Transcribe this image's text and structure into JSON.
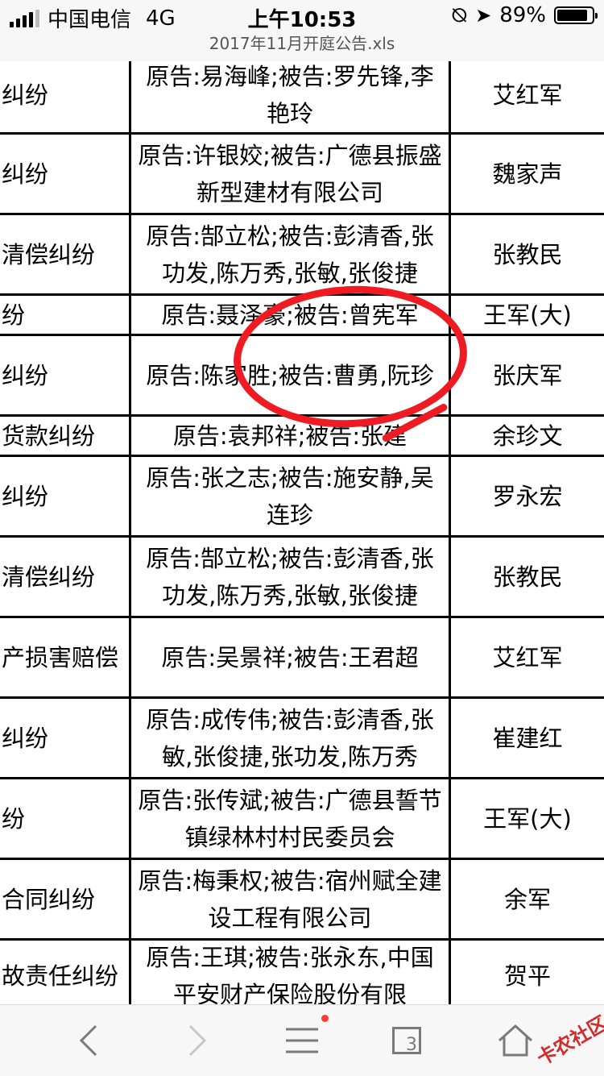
{
  "status_bar": {
    "carrier": "中国电信",
    "network": "4G",
    "time": "上午10:53",
    "battery_percent": "89%",
    "battery_level": 0.89
  },
  "file_title": "2017年11月开庭公告.xls",
  "rows": [
    {
      "cause": "纠纷",
      "parties": "原告:易海峰;被告:罗先锋,李艳玲",
      "judge": "艾红军"
    },
    {
      "cause": "纠纷",
      "parties": "原告:许银姣;被告:广德县振盛新型建材有限公司",
      "judge": "魏家声"
    },
    {
      "cause": "清偿纠纷",
      "parties": "原告:郜立松;被告:彭清香,张功发,陈万秀,张敏,张俊捷",
      "judge": "张教民"
    },
    {
      "cause": "纷",
      "parties": "原告:聂泽豪;被告:曾宪军",
      "judge": "王军(大)"
    },
    {
      "cause": "纠纷",
      "parties": "原告:陈家胜;被告:曹勇,阮珍",
      "judge": "张庆军"
    },
    {
      "cause": "货款纠纷",
      "parties": "原告:袁邦祥;被告:张建",
      "judge": "余珍文"
    },
    {
      "cause": "纠纷",
      "parties": "原告:张之志;被告:施安静,吴连珍",
      "judge": "罗永宏"
    },
    {
      "cause": "清偿纠纷",
      "parties": "原告:郜立松;被告:彭清香,张功发,陈万秀,张敏,张俊捷",
      "judge": "张教民"
    },
    {
      "cause": "产损害赔偿",
      "parties": "原告:吴景祥;被告:王君超",
      "judge": "艾红军"
    },
    {
      "cause": "纠纷",
      "parties": "原告:成传伟;被告:彭清香,张敏,张俊捷,张功发,陈万秀",
      "judge": "崔建红"
    },
    {
      "cause": "纷",
      "parties": "原告:张传斌;被告:广德县誓节镇绿林村村民委员会",
      "judge": "王军(大)"
    },
    {
      "cause": "合同纠纷",
      "parties": "原告:梅秉权;被告:宿州赋全建设工程有限公司",
      "judge": "余军"
    },
    {
      "cause": "故责任纠纷",
      "parties": "原告:王琪;被告:张永东,中国平安财产保险股份有限",
      "judge": "贺平"
    }
  ],
  "toolbar": {
    "tabs_count": "3"
  },
  "watermark": "卡农社区"
}
